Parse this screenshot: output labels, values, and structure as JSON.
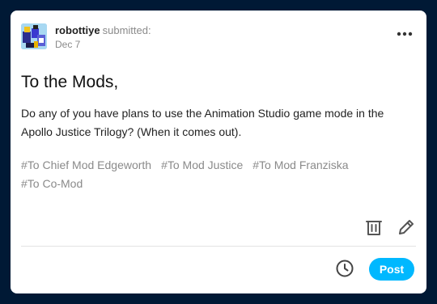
{
  "post": {
    "author": "robottiye",
    "action": "submitted:",
    "date": "Dec 7",
    "title": "To the Mods,",
    "body": "Do any of you have plans to use the Animation Studio game mode in the Apollo Justice Trilogy? (When it comes out).",
    "tags": [
      "#To Chief Mod Edgeworth",
      "#To Mod Justice",
      "#To Mod Franziska",
      "#To Co-Mod"
    ]
  },
  "actions": {
    "post_label": "Post"
  },
  "icons": {
    "menu": "more-dots-icon",
    "delete": "trash-icon",
    "edit": "pencil-icon",
    "schedule": "clock-icon"
  },
  "colors": {
    "background": "#001935",
    "card": "#ffffff",
    "accent": "#00b8ff",
    "muted_text": "#8a8a8a"
  }
}
